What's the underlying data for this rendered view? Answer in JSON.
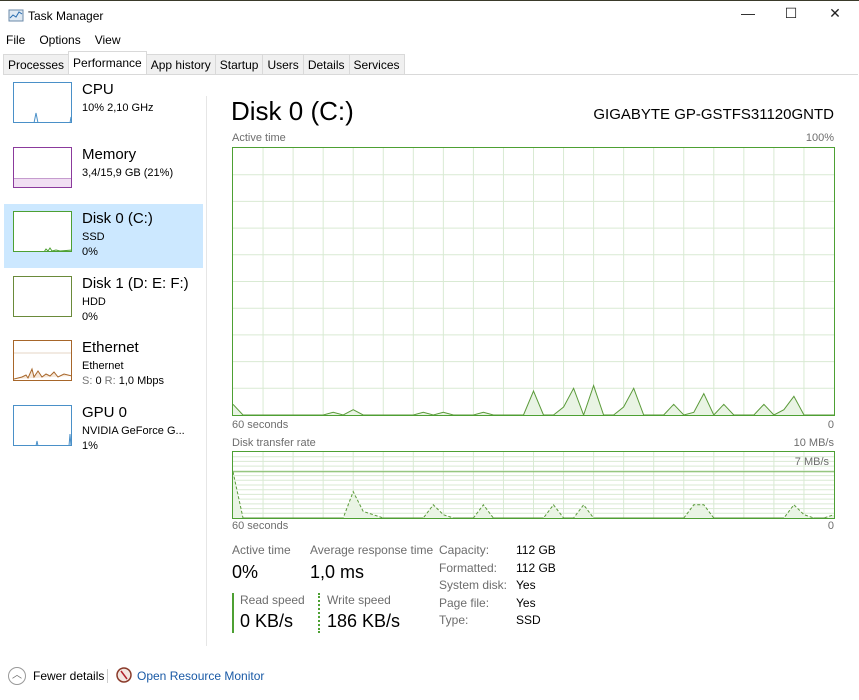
{
  "window": {
    "title": "Task Manager",
    "minimize": "—",
    "maximize": "☐",
    "close": "✕"
  },
  "menu": [
    "File",
    "Options",
    "View"
  ],
  "tabs": [
    "Processes",
    "Performance",
    "App history",
    "Startup",
    "Users",
    "Details",
    "Services"
  ],
  "sidebar": [
    {
      "name": "CPU",
      "line1": "10% 2,10 GHz",
      "line2": "",
      "color": "#4a90c8"
    },
    {
      "name": "Memory",
      "line1": "3,4/15,9 GB (21%)",
      "line2": "",
      "color": "#8b3a9c"
    },
    {
      "name": "Disk 0 (C:)",
      "line1": "SSD",
      "line2": "0%",
      "color": "#4da033"
    },
    {
      "name": "Disk 1 (D: E: F:)",
      "line1": "HDD",
      "line2": "0%",
      "color": "#6a8a3a"
    },
    {
      "name": "Ethernet",
      "line1": "Ethernet",
      "line2_s": "S:",
      "line2_sv": "0",
      "line2_r": "R:",
      "line2_rv": "1,0 Mbps",
      "color": "#a7662a"
    },
    {
      "name": "GPU 0",
      "line1": "NVIDIA GeForce G...",
      "line2": "1%",
      "color": "#4a90c8"
    }
  ],
  "main": {
    "title": "Disk 0 (C:)",
    "model": "GIGABYTE GP-GSTFS31120GNTD",
    "chart1": {
      "label": "Active time",
      "max": "100%",
      "xlabel": "60 seconds",
      "xend": "0"
    },
    "chart2": {
      "label": "Disk transfer rate",
      "max": "10 MB/s",
      "line_label": "7 MB/s",
      "xlabel": "60 seconds",
      "xend": "0"
    },
    "stats": {
      "active_time_label": "Active time",
      "active_time": "0%",
      "avg_resp_label": "Average response time",
      "avg_resp": "1,0 ms",
      "read_label": "Read speed",
      "read": "0 KB/s",
      "write_label": "Write speed",
      "write": "186 KB/s"
    },
    "props": [
      [
        "Capacity:",
        "112 GB"
      ],
      [
        "Formatted:",
        "112 GB"
      ],
      [
        "System disk:",
        "Yes"
      ],
      [
        "Page file:",
        "Yes"
      ],
      [
        "Type:",
        "SSD"
      ]
    ]
  },
  "footer": {
    "fewer": "Fewer details",
    "resmon": "Open Resource Monitor"
  },
  "colors": {
    "accent": "#4da033",
    "fill": "#e9f4e4",
    "grid": "#d9ead3"
  },
  "chart_data": [
    {
      "type": "area",
      "title": "Active time",
      "ylim": [
        0,
        100
      ],
      "unit": "%",
      "x_seconds": "60 to 0",
      "values": [
        4,
        0,
        0,
        0,
        0,
        0,
        0,
        0,
        0,
        0,
        1,
        0,
        2,
        0,
        0,
        0,
        0,
        0,
        0,
        1,
        0,
        1,
        0,
        0,
        0,
        1,
        0,
        0,
        0,
        0,
        9,
        0,
        0,
        3,
        10,
        0,
        11,
        0,
        0,
        3,
        10,
        0,
        0,
        0,
        4,
        0,
        1,
        8,
        0,
        4,
        0,
        0,
        0,
        4,
        0,
        2,
        7,
        0,
        0,
        0,
        0
      ]
    },
    {
      "type": "line",
      "title": "Disk transfer rate",
      "ylim": [
        0,
        10
      ],
      "unit": "MB/s",
      "reference_line": 7,
      "series": [
        {
          "name": "Write speed",
          "values": [
            7,
            0,
            0,
            0,
            0,
            0,
            0,
            0,
            0,
            0,
            0,
            0,
            4,
            1,
            0.5,
            0,
            0,
            0,
            0,
            0,
            2,
            0.5,
            0,
            0,
            0,
            2,
            0,
            0,
            0,
            0,
            0,
            0,
            2,
            0,
            0,
            2,
            0,
            0,
            0,
            0,
            0,
            0,
            0,
            0,
            0,
            0,
            2,
            2,
            0,
            0,
            0,
            0,
            0,
            0,
            0,
            0,
            2,
            0.5,
            0,
            0,
            0.5
          ]
        },
        {
          "name": "Read speed",
          "values": [
            0,
            0,
            0,
            0,
            0,
            0,
            0,
            0,
            0,
            0,
            0,
            0,
            0,
            0,
            0,
            0,
            0,
            0,
            0,
            0,
            0,
            0,
            0,
            0,
            0,
            0,
            0,
            0,
            0,
            0,
            0,
            0,
            0,
            0,
            0,
            0,
            0,
            0,
            0,
            0,
            0,
            0,
            0,
            0,
            0,
            0,
            0,
            0,
            0,
            0,
            0,
            0,
            0,
            0,
            0,
            0,
            0,
            0,
            0,
            0,
            0
          ]
        }
      ]
    }
  ]
}
